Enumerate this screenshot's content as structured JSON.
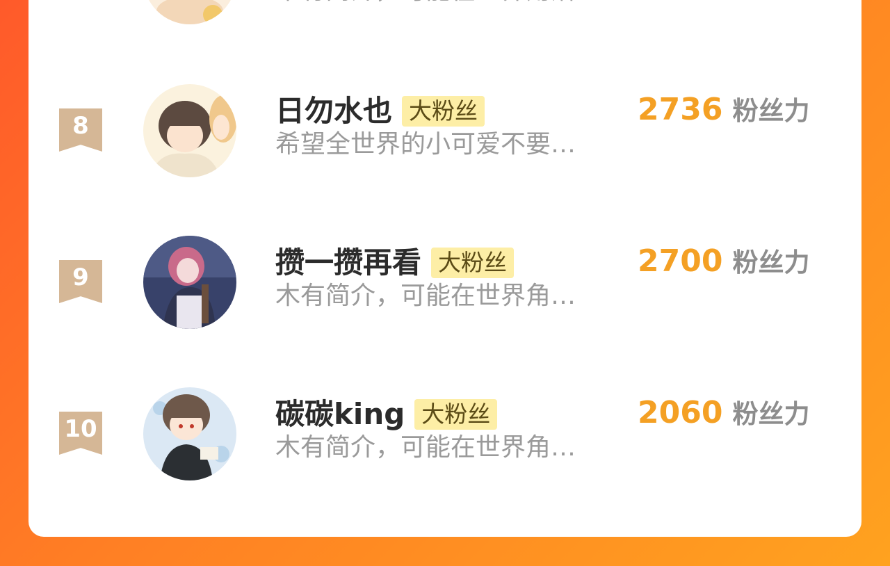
{
  "list": {
    "prev_row": {
      "bio": "木有简介，可能在世界角落…"
    },
    "rows": [
      {
        "rank": "8",
        "name": "日勿水也",
        "badge": "大粉丝",
        "bio": "希望全世界的小可爱不要…",
        "score": "2736",
        "score_unit": "粉丝力"
      },
      {
        "rank": "9",
        "name": "攒一攒再看",
        "badge": "大粉丝",
        "bio": "木有简介，可能在世界角…",
        "score": "2700",
        "score_unit": "粉丝力"
      },
      {
        "rank": "10",
        "name": "碳碳king",
        "badge": "大粉丝",
        "bio": "木有简介，可能在世界角…",
        "score": "2060",
        "score_unit": "粉丝力"
      }
    ]
  },
  "colors": {
    "background_start": "#ff5a2a",
    "background_end": "#ffa21f",
    "card": "#ffffff",
    "rank_ribbon": "#d5b796",
    "badge_bg": "#fdeea6",
    "score": "#f4a024",
    "name": "#2b2b2b",
    "bio": "#9a9a9a"
  }
}
